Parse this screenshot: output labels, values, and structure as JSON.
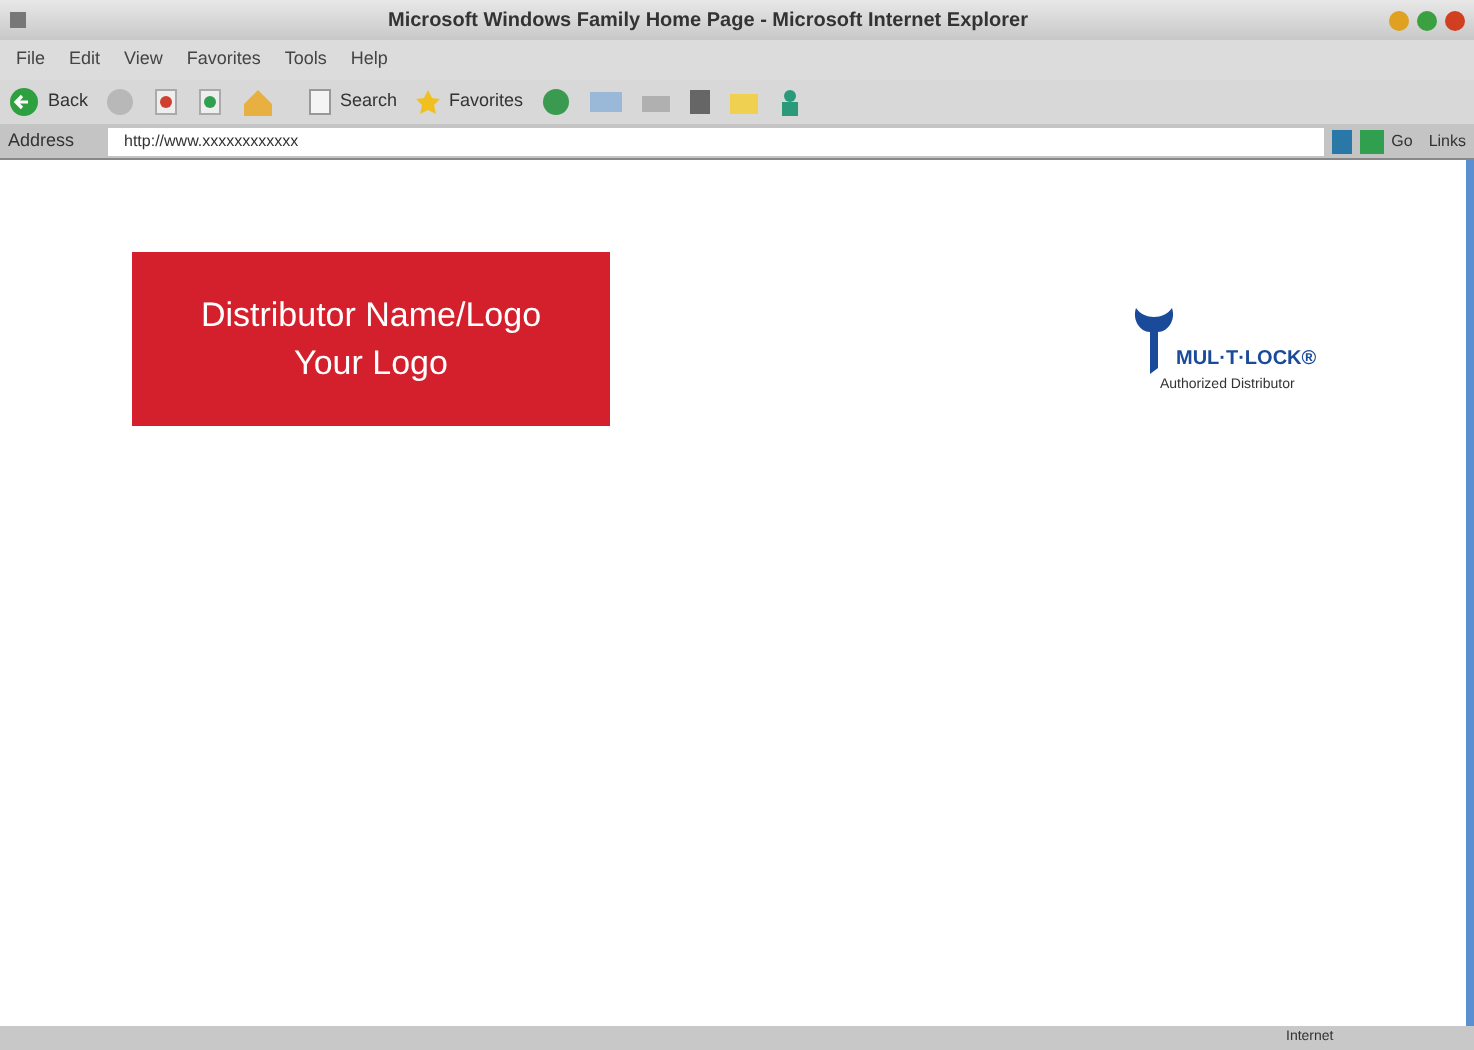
{
  "window": {
    "title": "Microsoft Windows Family Home Page - Microsoft Internet Explorer"
  },
  "menu": [
    "File",
    "Edit",
    "View",
    "Favorites",
    "Tools",
    "Help"
  ],
  "toolbar": {
    "back": "Back",
    "search": "Search",
    "favorites": "Favorites"
  },
  "address_bar": {
    "label": "Address",
    "value": "http://www.xxxxxxxxxxxx",
    "go": "Go",
    "links": "Links"
  },
  "page": {
    "placeholder_logo": [
      "Distributor Name/Logo",
      "Your Logo"
    ],
    "brand": "MUL·T·LOCK®",
    "brand_caption": "Authorized Distributor"
  },
  "status_bar": {
    "zone": "Internet"
  }
}
